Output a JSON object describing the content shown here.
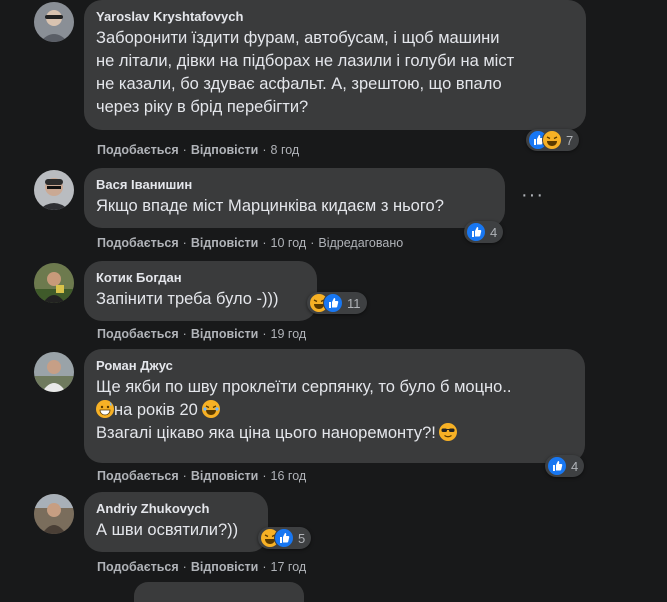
{
  "actions": {
    "like": "Подобається",
    "reply": "Відповісти",
    "sep": "·"
  },
  "more_label": "···",
  "colors": {
    "background": "#18191a",
    "bubble": "#3a3b3c",
    "secondary_text": "#b0b3b8",
    "like_blue": "#1877f2",
    "haha_yellow": "#f7b125"
  },
  "comments": [
    {
      "author": "Yaroslav Kryshtafovych",
      "lines": [
        "Заборонити їздити фурам, автобусам, і щоб машини",
        "не літали, дівки на підборах не лазили і голуби на міст",
        "не казали, бо здуває асфальт. А, зрештою, що впало",
        "через ріку в брід перебігти?"
      ],
      "time": "8 год",
      "reactions": [
        "like-icon",
        "haha-icon"
      ],
      "reaction_count": "7"
    },
    {
      "author": "Вася Іванишин",
      "lines": [
        "Якщо впаде міст Марцинківа кидаєм з нього?"
      ],
      "time": "10 год",
      "edited": "Відредаговано",
      "reactions": [
        "like-icon"
      ],
      "reaction_count": "4"
    },
    {
      "author": "Котик Богдан",
      "lines": [
        "Запінити треба було -)))"
      ],
      "time": "19 год",
      "reactions": [
        "haha-icon",
        "like-icon"
      ],
      "reaction_count": "11"
    },
    {
      "author": "Роман Джус",
      "lines": [
        "Ще якби по шву проклеїти серпянку, то було б моцно..",
        "на років 20",
        "Взагалі цікаво яка ціна цього наноремонту?!"
      ],
      "time": "16 год",
      "reactions": [
        "like-icon"
      ],
      "reaction_count": "4"
    },
    {
      "author": "Andriy Zhukovych",
      "lines": [
        "А шви освятили?))"
      ],
      "time": "17 год",
      "reactions": [
        "haha-icon",
        "like-icon"
      ],
      "reaction_count": "5"
    }
  ]
}
